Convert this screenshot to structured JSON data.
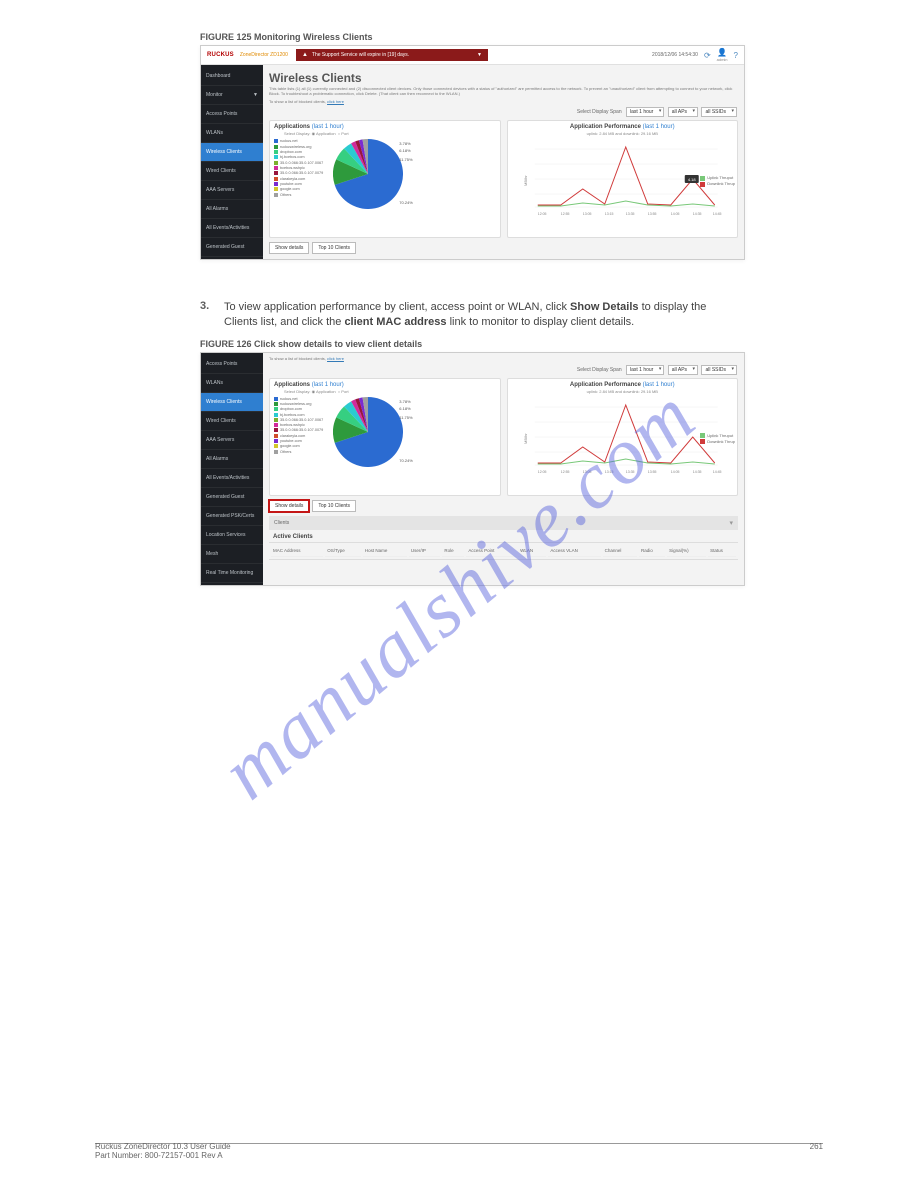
{
  "captions": {
    "fig1": "FIGURE 125 Monitoring Wireless Clients",
    "fig2": "FIGURE 126 Click show details to view client details"
  },
  "topbar": {
    "brand_sub": "ZoneDirector  ZD1200",
    "banner_text": "The Support Service will expire in [19] days.",
    "datetime": "2018/12/06 14:54:30",
    "user_label": "admin"
  },
  "sidebar": {
    "items_fig1": [
      "Dashboard",
      "Monitor",
      "Access Points",
      "WLANs",
      "Wireless Clients",
      "Wired Clients",
      "AAA Servers",
      "All Alarms",
      "All Events/Activities",
      "Generated Guest"
    ],
    "items_fig2": [
      "Access Points",
      "WLANs",
      "Wireless Clients",
      "Wired Clients",
      "AAA Servers",
      "All Alarms",
      "All Events/Activities",
      "Generated Guest",
      "Generated PSK/Certs",
      "Location Services",
      "Mesh",
      "Real Time Monitoring"
    ],
    "active_item": "Wireless Clients"
  },
  "page": {
    "title": "Wireless Clients",
    "desc_1": "This table lists (1) all (1) currently connected and (2) disconnected client devices. Only those connected devices with a status of \"authorized\" are permitted access to the network. To prevent an \"unauthorized\" client from attempting to connect to your network, click Block. To troubleshoot a problematic connection, click Delete. (That client can then reconnect to the WLAN.)",
    "desc_2_prefix": "To show a list of blocked clients, ",
    "desc_2_link": "click here"
  },
  "filters": {
    "label": "Select Display Span",
    "span": "last 1 hour",
    "aps": "all APs",
    "ssids": "all SSIDs"
  },
  "applications_panel": {
    "title": "Applications",
    "title_sub": "(last 1 hour)",
    "radio1": "Application",
    "radio2": "Port",
    "select_display": "Select Display:",
    "legend": [
      {
        "label": "ruckus.net",
        "color": "#2b6bd1"
      },
      {
        "label": "ruckuswireless.org",
        "color": "#2e9a3c"
      },
      {
        "label": "dropbox.com",
        "color": "#36cf81"
      },
      {
        "label": "bj.bcebos.com",
        "color": "#2bcbd1"
      },
      {
        "label": "35.0.0.066:35.0.107.0067",
        "color": "#7caf2f"
      },
      {
        "label": "bcebos.wshpic",
        "color": "#d12b9b"
      },
      {
        "label": "35.0.0.066:35.0.107.0079",
        "color": "#99163d"
      },
      {
        "label": "clarakeyla.com",
        "color": "#d14e2b"
      },
      {
        "label": "youtube.com",
        "color": "#7a2bd1"
      },
      {
        "label": "google.com",
        "color": "#d1c62b"
      },
      {
        "label": "Others",
        "color": "#a0a0a0"
      }
    ],
    "pct_labels": [
      "3.78%",
      "6.18%",
      "11.75%",
      "70.24%"
    ]
  },
  "performance_panel": {
    "title": "Application Performance",
    "title_sub": "(last 1 hour)",
    "subtitle": "uplink: 2.84 MB and downlink: 29.16 MB",
    "ylabel": "MB/hr",
    "x_ticks": [
      "12:05",
      "12:55",
      "13:05",
      "13:15",
      "13:35",
      "13:55",
      "14:05",
      "14:35",
      "14:45"
    ],
    "legend": [
      {
        "label": "Uplink Thruput",
        "color": "#79c879"
      },
      {
        "label": "Downlink Thrup",
        "color": "#d03a3a"
      }
    ],
    "tooltip": "4.18"
  },
  "buttons": {
    "show_details": "Show details",
    "top10": "Top 10 Clients"
  },
  "clients_section": {
    "header": "Clients",
    "active_title": "Active Clients",
    "columns": [
      "MAC Address",
      "OS/Type",
      "Host Name",
      "User/IP",
      "Role",
      "Access Point",
      "WLAN",
      "Access VLAN",
      "Channel",
      "Radio",
      "Signal(%)",
      "Status"
    ]
  },
  "step": {
    "n": "3.",
    "text_before": "To view application performance by client, access point or WLAN, click ",
    "text_bold": "Show Details",
    "text_after": " to display the Clients list, and click the ",
    "text_bold2": "client MAC address",
    "text_after2": " link to monitor to display client details."
  },
  "footer": {
    "left": "Ruckus ZoneDirector 10.3 User Guide\nPart Number: 800-72157-001 Rev A",
    "right": "261"
  },
  "watermark": "manualshive.com",
  "chart_data": [
    {
      "type": "pie",
      "title": "Applications (last 1 hour)",
      "series": [
        {
          "name": "ruckus.net",
          "value": 70.24
        },
        {
          "name": "ruckuswireless.org",
          "value": 11.75
        },
        {
          "name": "dropbox.com",
          "value": 6.18
        },
        {
          "name": "bj.bcebos.com",
          "value": 3.78
        },
        {
          "name": "bcebos.wshpic",
          "value": 2.0
        },
        {
          "name": "clarakeyla.com",
          "value": 1.5
        },
        {
          "name": "youtube.com",
          "value": 1.5
        },
        {
          "name": "google.com",
          "value": 1.5
        },
        {
          "name": "Others",
          "value": 1.55
        }
      ]
    },
    {
      "type": "line",
      "title": "Application Performance (last 1 hour)",
      "xlabel": "",
      "ylabel": "MB/hr",
      "x": [
        "12:05",
        "12:55",
        "13:05",
        "13:15",
        "13:35",
        "13:55",
        "14:05",
        "14:35",
        "14:45"
      ],
      "series": [
        {
          "name": "Downlink Thruput",
          "values": [
            0.3,
            0.3,
            2.5,
            0.5,
            11.0,
            0.4,
            0.3,
            4.18,
            0.3
          ]
        },
        {
          "name": "Uplink Thruput",
          "values": [
            0.2,
            0.2,
            0.5,
            0.3,
            0.6,
            0.3,
            0.2,
            0.4,
            0.2
          ]
        }
      ],
      "ylim": [
        0,
        11
      ]
    }
  ]
}
